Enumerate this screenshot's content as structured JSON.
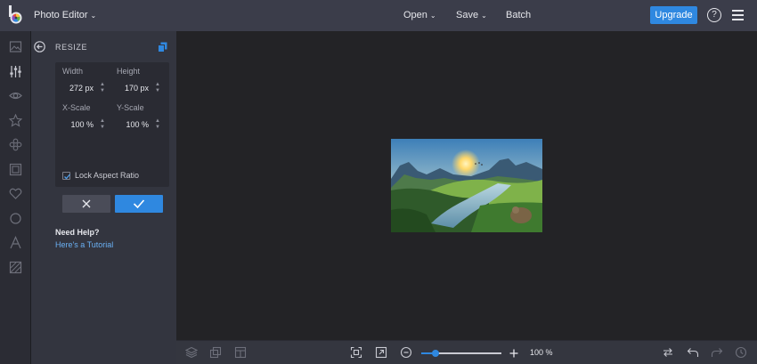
{
  "app": {
    "title": "Photo Editor"
  },
  "header": {
    "menu": [
      {
        "label": "Open",
        "has_dropdown": true
      },
      {
        "label": "Save",
        "has_dropdown": true
      },
      {
        "label": "Batch",
        "has_dropdown": false
      }
    ],
    "upgrade_label": "Upgrade",
    "help_label": "?"
  },
  "sidebar": {
    "icons": [
      "image-icon",
      "sliders-icon",
      "eye-icon",
      "star-icon",
      "effects-icon",
      "frame-icon",
      "heart-icon",
      "circle-icon",
      "text-icon",
      "texture-icon"
    ]
  },
  "panel": {
    "title": "RESIZE",
    "width_label": "Width",
    "width_value": "272 px",
    "height_label": "Height",
    "height_value": "170 px",
    "xscale_label": "X-Scale",
    "xscale_value": "100 %",
    "yscale_label": "Y-Scale",
    "yscale_value": "100 %",
    "lock_label": "Lock Aspect Ratio",
    "lock_checked": true,
    "help_heading": "Need Help?",
    "help_link": "Here's a Tutorial"
  },
  "bottom": {
    "zoom_label": "100 %",
    "zoom_fraction": 0.18
  },
  "colors": {
    "accent": "#2f88e0",
    "topbar": "#3b3d4a",
    "panel": "#33353f",
    "canvas": "#232326"
  }
}
